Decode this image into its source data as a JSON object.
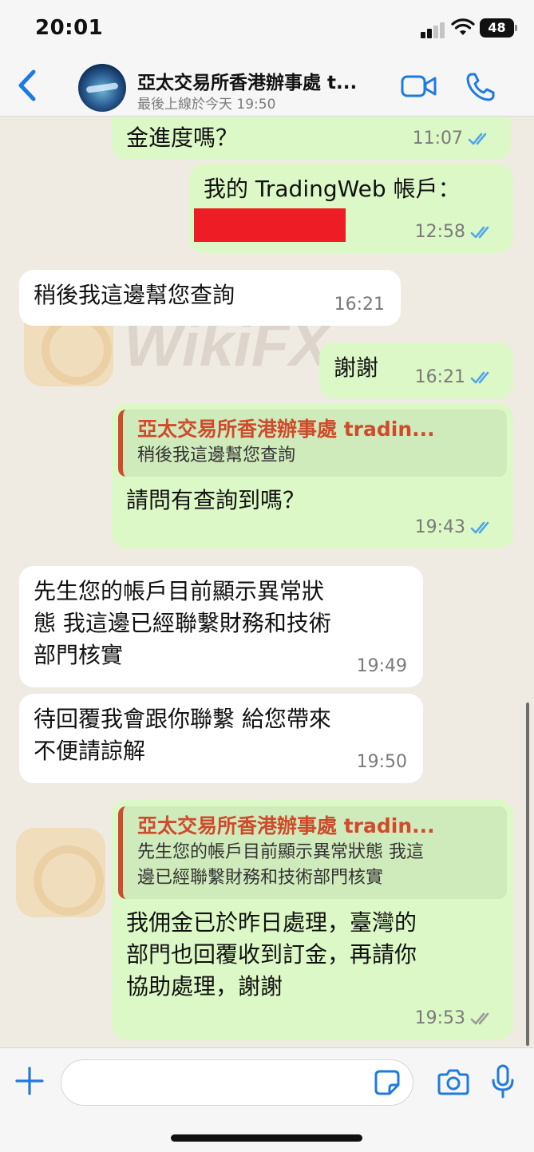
{
  "status_bar": {
    "time": "20:01",
    "battery": "48"
  },
  "header": {
    "contact_name": "亞太交易所香港辦事處 t...",
    "last_seen": "最後上線於今天 19:50"
  },
  "messages": [
    {
      "direction": "out",
      "text": "金進度嗎？",
      "time": "11:07",
      "read": true
    },
    {
      "direction": "out",
      "text": "我的 TradingWeb 帳戶：",
      "time": "12:58",
      "read": true,
      "redacted": true
    },
    {
      "direction": "in",
      "text": "稍後我這邊幫您查詢",
      "time": "16:21"
    },
    {
      "direction": "out",
      "text": "謝謝",
      "time": "16:21",
      "read": true
    },
    {
      "direction": "out",
      "text": "請問有查詢到嗎？",
      "time": "19:43",
      "read": true,
      "quote": {
        "name": "亞太交易所香港辦事處 tradin...",
        "text": "稍後我這邊幫您查詢"
      }
    },
    {
      "direction": "in",
      "text": "先生您的帳戶目前顯示異常狀\n態 我這邊已經聯繫財務和技術\n部門核實",
      "time": "19:49"
    },
    {
      "direction": "in",
      "text": "待回覆我會跟你聯繫 給您帶來\n不便請諒解",
      "time": "19:50"
    },
    {
      "direction": "out",
      "text": "我佣金已於昨日處理，臺灣的\n部門也回覆收到訂金，再請你\n協助處理，謝謝",
      "time": "19:53",
      "read": false,
      "quote": {
        "name": "亞太交易所香港辦事處 tradin...",
        "text": "先生您的帳戶目前顯示異常狀態 我這\n邊已經聯繫財務和技術部門核實"
      }
    }
  ],
  "watermark": "WikiFX",
  "input": {
    "value": ""
  },
  "colors": {
    "outgoing_bubble": "#dcf8c6",
    "incoming_bubble": "#ffffff",
    "accent": "#1f7ae0",
    "quote_name": "#d04a2c",
    "read_ticks": "#4fa8e8"
  },
  "icons": [
    "back-chevron-icon",
    "video-call-icon",
    "phone-icon",
    "double-check-icon",
    "plus-icon",
    "sticker-icon",
    "camera-icon",
    "microphone-icon"
  ]
}
